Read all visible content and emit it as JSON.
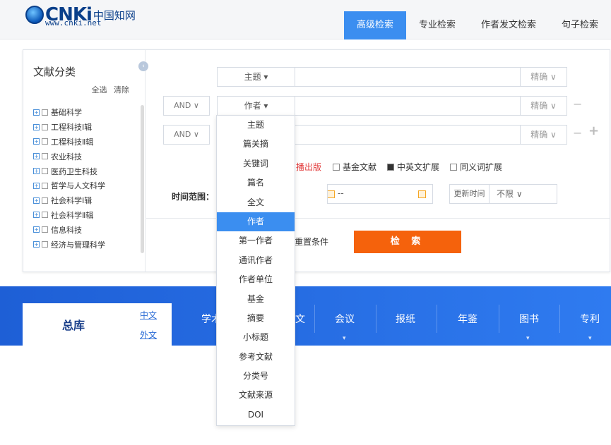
{
  "header": {
    "logo_cnki": "CNKi",
    "logo_cn": "中国知网",
    "logo_url": "www.cnki.net",
    "tabs": [
      "高级检索",
      "专业检索",
      "作者发文检索",
      "句子检索"
    ],
    "active_tab": "高级检索"
  },
  "sidebar": {
    "title": "文献分类",
    "select_all": "全选",
    "clear": "清除",
    "collapse_icon": "‹",
    "items": [
      "基础科学",
      "工程科技Ⅰ辑",
      "工程科技Ⅱ辑",
      "农业科技",
      "医药卫生科技",
      "哲学与人文科学",
      "社会科学Ⅰ辑",
      "社会科学Ⅱ辑",
      "信息科技",
      "经济与管理科学"
    ]
  },
  "search_rows": [
    {
      "field": "主题 ▾",
      "precise": "精确 ∨"
    },
    {
      "logic": "AND ∨",
      "field": "作者 ▾",
      "precise": "精确 ∨"
    },
    {
      "logic": "AND ∨",
      "precise": "精确 ∨"
    }
  ],
  "options": {
    "red_text": "播出版",
    "checkboxes": [
      {
        "label": "基金文献",
        "checked": false
      },
      {
        "label": "中英文扩展",
        "checked": true
      },
      {
        "label": "同义词扩展",
        "checked": false
      }
    ]
  },
  "time": {
    "label": "时间范围：",
    "dash": "--",
    "update_label": "更新时间",
    "update_value": "不限 ∨"
  },
  "actions": {
    "reset": "重置条件",
    "search": "检 索"
  },
  "dropdown": {
    "items": [
      "主题",
      "篇关摘",
      "关键词",
      "篇名",
      "全文",
      "作者",
      "第一作者",
      "通讯作者",
      "作者单位",
      "基金",
      "摘要",
      "小标题",
      "参考文献",
      "分类号",
      "文献来源",
      "DOI"
    ],
    "selected": "作者"
  },
  "db_bar": {
    "zongku": "总库",
    "lang_cn": "中文",
    "lang_en": "外文",
    "tabs": [
      "学术",
      "文",
      "会议",
      "报纸",
      "年鉴",
      "图书",
      "专利"
    ]
  },
  "colors": {
    "accent": "#3b8ef0",
    "search_button": "#f5620c",
    "band": "#2f7bf0"
  }
}
